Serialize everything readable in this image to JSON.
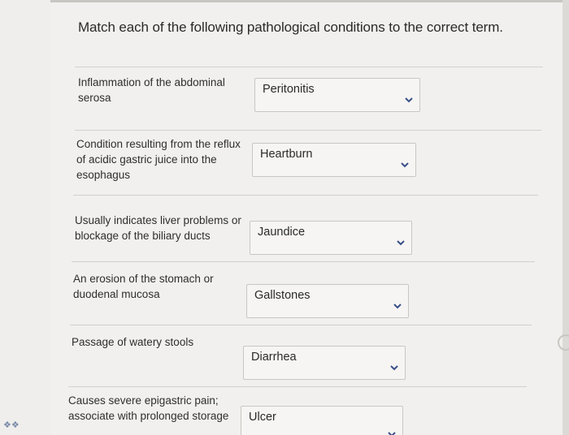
{
  "question": {
    "title": "Match each of the following pathological conditions to the correct term."
  },
  "items": [
    {
      "prompt": "Inflammation of the abdominal serosa",
      "selected": "Peritonitis"
    },
    {
      "prompt": "Condition resulting from the reflux of acidic gastric juice into the esophagus",
      "selected": "Heartburn"
    },
    {
      "prompt": "Usually indicates liver problems or blockage of the biliary ducts",
      "selected": "Jaundice"
    },
    {
      "prompt": "An erosion of the stomach or duodenal mucosa",
      "selected": "Gallstones"
    },
    {
      "prompt": "Passage of watery stools",
      "selected": "Diarrhea"
    },
    {
      "prompt": "Causes severe epigastric pain; associate with prolonged storage",
      "selected": "Ulcer"
    }
  ],
  "icons": {
    "dropdown": "chevron-down-icon",
    "corner": "app-icon"
  },
  "colors": {
    "background": "#f1f0ee",
    "text": "#2a2a2a",
    "border": "#c9c7c3",
    "chevron": "#3a4f8a"
  }
}
